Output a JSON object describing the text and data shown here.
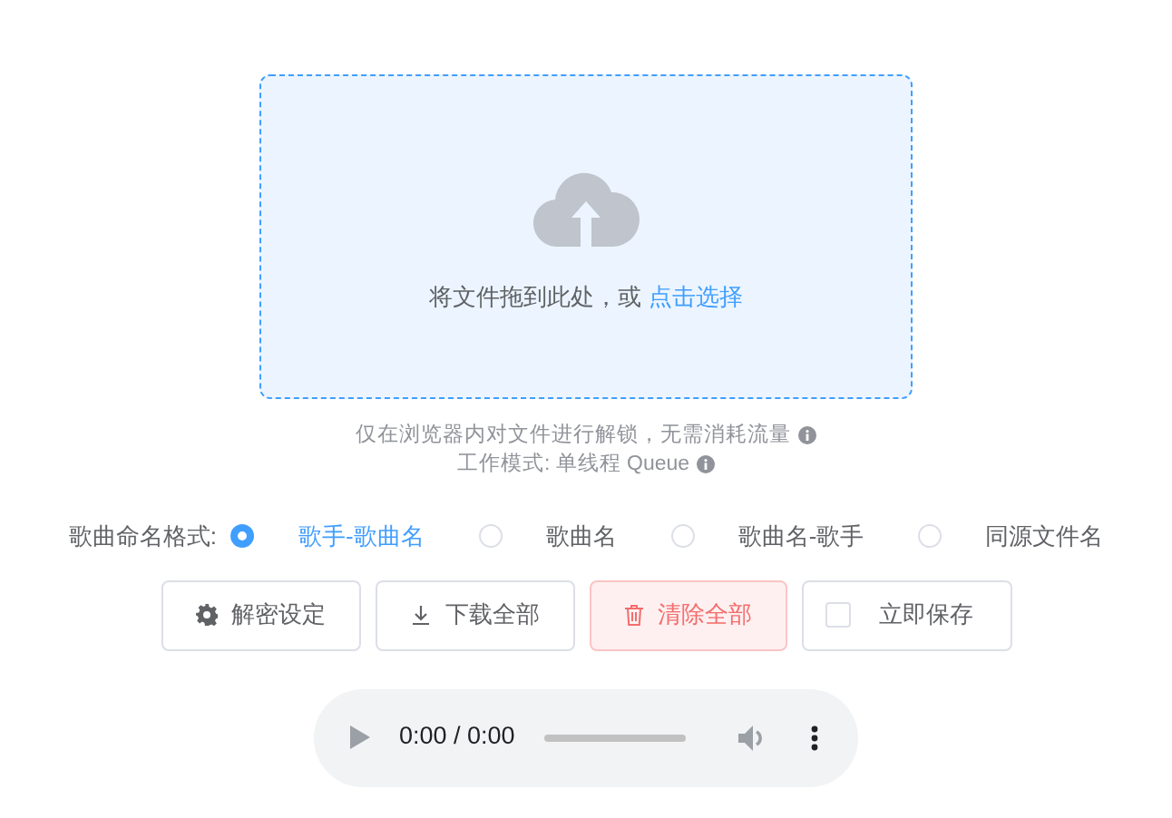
{
  "upload": {
    "prompt": "将文件拖到此处，或",
    "link": "点击选择"
  },
  "notes": [
    {
      "text": "仅在浏览器内对文件进行解锁，无需消耗流量"
    },
    {
      "text": "工作模式: 单线程 Queue"
    }
  ],
  "naming": {
    "label": "歌曲命名格式:",
    "options": [
      {
        "label": "歌手-歌曲名",
        "selected": true
      },
      {
        "label": "歌曲名",
        "selected": false
      },
      {
        "label": "歌曲名-歌手",
        "selected": false
      },
      {
        "label": "同源文件名",
        "selected": false
      }
    ]
  },
  "buttons": [
    {
      "kind": "gear",
      "label": "解密设定"
    },
    {
      "kind": "download",
      "label": "下载全部"
    },
    {
      "kind": "danger",
      "label": "清除全部"
    },
    {
      "kind": "checkbox",
      "label": "立即保存",
      "checked": false
    }
  ],
  "player": {
    "time": "0:00 / 0:00",
    "level": 0
  }
}
